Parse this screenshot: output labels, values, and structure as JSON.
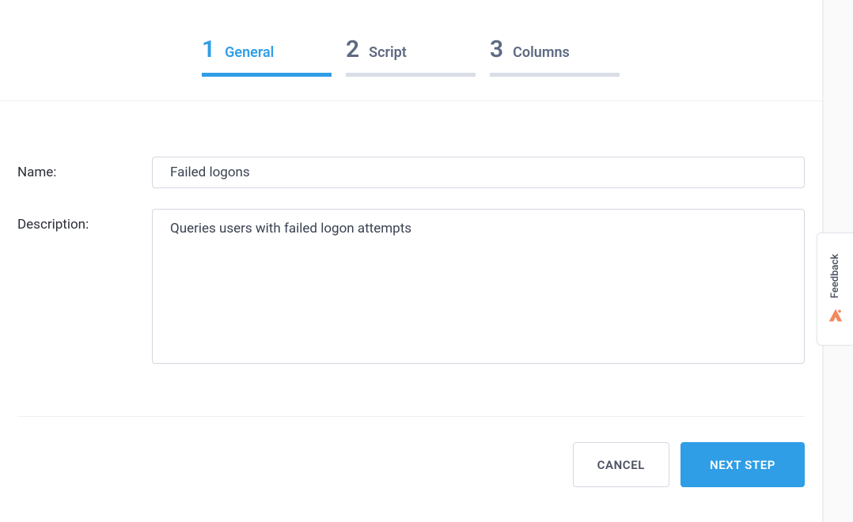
{
  "stepper": {
    "steps": [
      {
        "number": "1",
        "label": "General",
        "active": true
      },
      {
        "number": "2",
        "label": "Script",
        "active": false
      },
      {
        "number": "3",
        "label": "Columns",
        "active": false
      }
    ]
  },
  "form": {
    "name_label": "Name:",
    "name_value": "Failed logons",
    "description_label": "Description:",
    "description_value": "Queries users with failed logon attempts"
  },
  "footer": {
    "cancel_label": "CANCEL",
    "next_label": "NEXT STEP"
  },
  "feedback": {
    "label": "Feedback"
  }
}
